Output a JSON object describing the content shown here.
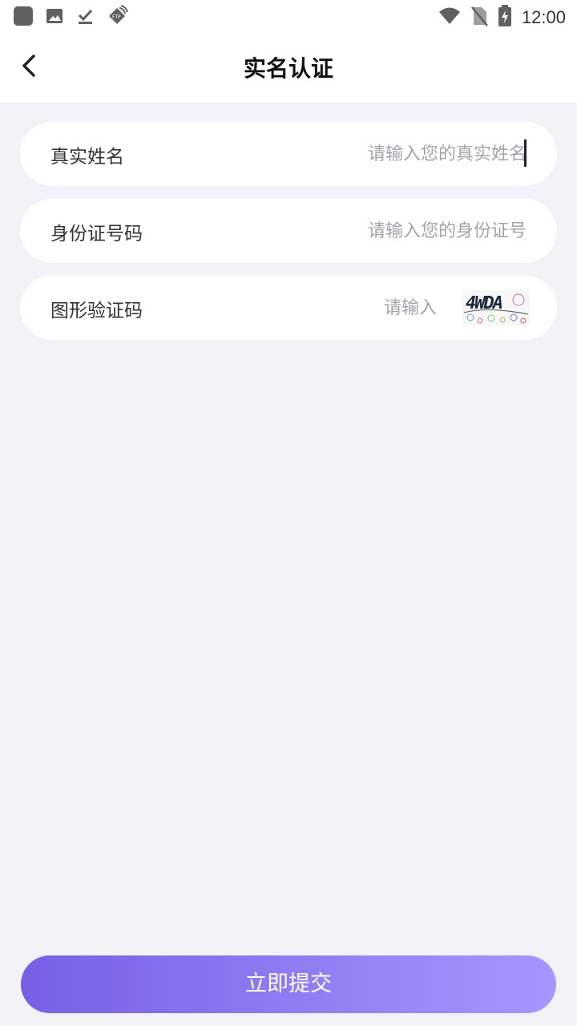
{
  "status_bar": {
    "time": "12:00",
    "left_icons": [
      "app-icon",
      "image-icon",
      "download-done-icon",
      "ftp-icon"
    ],
    "right_icons": [
      "wifi-icon",
      "no-sim-icon",
      "battery-charging-icon"
    ]
  },
  "header": {
    "title": "实名认证",
    "back_icon": "chevron-left-icon"
  },
  "form": {
    "name": {
      "label": "真实姓名",
      "placeholder": "请输入您的真实姓名",
      "value": ""
    },
    "id_number": {
      "label": "身份证号码",
      "placeholder": "请输入您的身份证号",
      "value": ""
    },
    "captcha": {
      "label": "图形验证码",
      "placeholder": "请输入",
      "value": "",
      "image_text": "4WDA"
    }
  },
  "submit": {
    "label": "立即提交"
  },
  "colors": {
    "page_bg": "#f2f2f7",
    "card_bg": "#ffffff",
    "placeholder": "#a3a3ab",
    "button_gradient_start": "#7760e6",
    "button_gradient_end": "#a796fe"
  }
}
